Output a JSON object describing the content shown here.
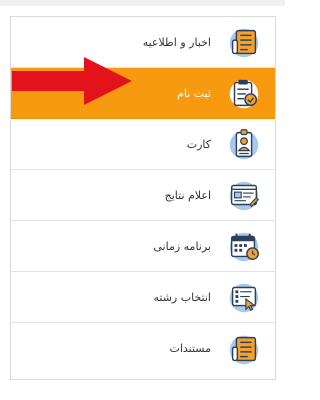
{
  "menu": {
    "items": [
      {
        "label": "اخبار و اطلاعیه",
        "icon": "newspaper-icon"
      },
      {
        "label": "ثبت نام",
        "icon": "clipboard-check-icon"
      },
      {
        "label": "کارت",
        "icon": "id-card-icon"
      },
      {
        "label": "اعلام نتایج",
        "icon": "results-board-icon"
      },
      {
        "label": "برنامه زمانی",
        "icon": "calendar-clock-icon"
      },
      {
        "label": "انتخاب رشته",
        "icon": "field-selection-icon"
      },
      {
        "label": "مستندات",
        "icon": "documents-icon"
      }
    ],
    "active_index": 1
  },
  "colors": {
    "active_bg": "#f89a10",
    "arrow": "#e3131b",
    "icon_dark": "#2d4059",
    "icon_orange": "#f5a12a",
    "icon_blue": "#a9c9ec"
  }
}
